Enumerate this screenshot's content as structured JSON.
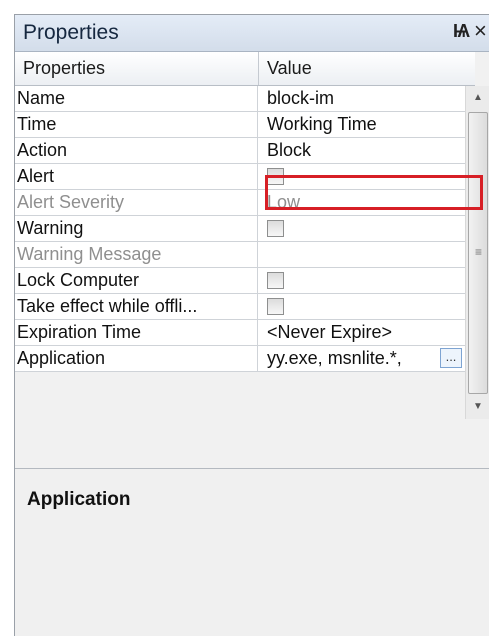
{
  "panel": {
    "title": "Properties",
    "pin_glyph": "Ѩ",
    "close_glyph": "×"
  },
  "grid": {
    "headers": [
      "Properties",
      "Value"
    ],
    "rows": [
      {
        "name": "Name",
        "value": "block-im",
        "type": "text",
        "disabled": false
      },
      {
        "name": "Time",
        "value": "Working Time",
        "type": "text",
        "disabled": false
      },
      {
        "name": "Action",
        "value": "Block",
        "type": "text",
        "disabled": false
      },
      {
        "name": "Alert",
        "value": "",
        "type": "checkbox",
        "disabled": false
      },
      {
        "name": "Alert Severity",
        "value": "Low",
        "type": "text",
        "disabled": true
      },
      {
        "name": "Warning",
        "value": "",
        "type": "checkbox",
        "disabled": false
      },
      {
        "name": "Warning Message",
        "value": "",
        "type": "text",
        "disabled": true
      },
      {
        "name": "Lock Computer",
        "value": "",
        "type": "checkbox",
        "disabled": false
      },
      {
        "name": "Take effect while offli...",
        "value": "",
        "type": "checkbox",
        "disabled": false
      },
      {
        "name": "Expiration Time",
        "value": "<Never Expire>",
        "type": "text",
        "disabled": false
      },
      {
        "name": "Application",
        "value": "yy.exe, msnlite.*,",
        "type": "text-button",
        "disabled": false
      }
    ],
    "ellipsis_label": "..."
  },
  "description": {
    "title": "Application"
  },
  "icons": {
    "pin": "pin-icon",
    "close": "close-icon",
    "scroll_up": "scroll-up-arrow-icon",
    "scroll_down": "scroll-down-arrow-icon"
  },
  "colors": {
    "highlight": "#d71f26",
    "title_bar": "#d3ddea"
  }
}
